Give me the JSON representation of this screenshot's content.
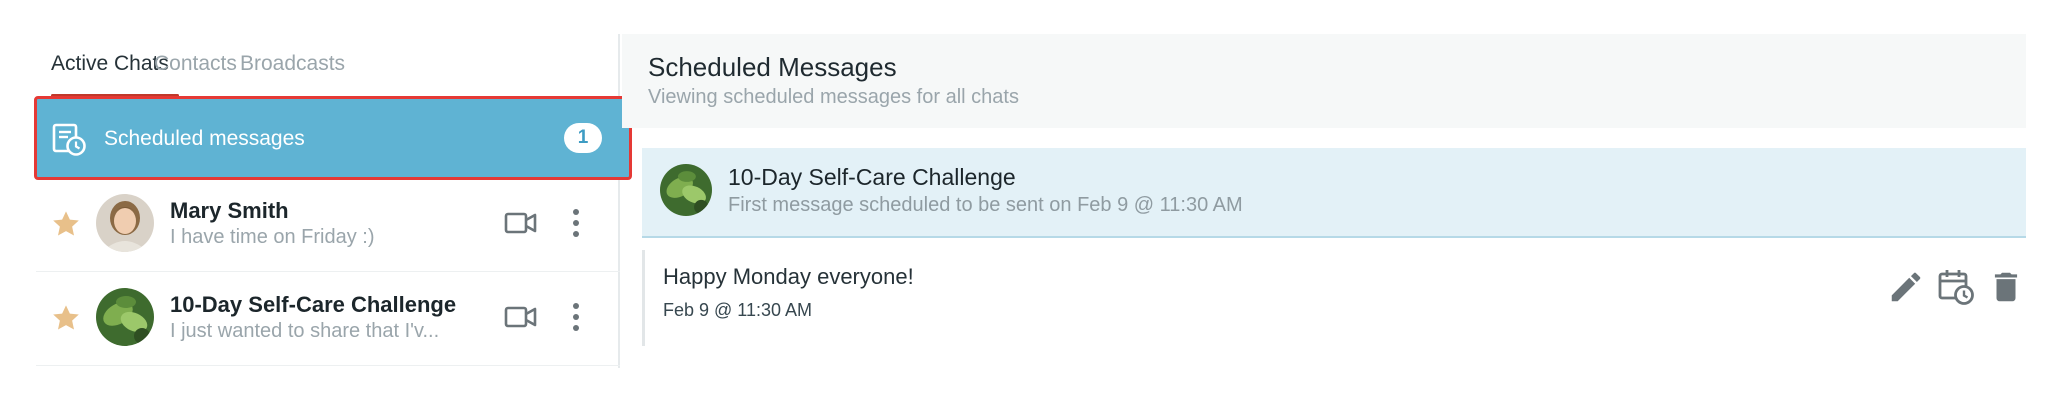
{
  "tabs": [
    {
      "label": "Active Chats",
      "active": true
    },
    {
      "label": "Contacts",
      "active": false
    },
    {
      "label": "Broadcasts",
      "active": false
    }
  ],
  "scheduled": {
    "label": "Scheduled messages",
    "count": "1",
    "icon": "scheduled-message-icon"
  },
  "chats": [
    {
      "name": "Mary Smith",
      "preview": "I have time on Friday :)",
      "starred": true
    },
    {
      "name": "10-Day Self-Care Challenge",
      "preview": "I just wanted to share that I'v...",
      "starred": true
    }
  ],
  "main": {
    "title": "Scheduled Messages",
    "subtitle": "Viewing scheduled messages for all chats",
    "group": {
      "name": "10-Day Self-Care Challenge",
      "subtitle": "First message scheduled to be sent on Feb 9 @ 11:30 AM"
    },
    "message": {
      "text": "Happy Monday everyone!",
      "time": "Feb 9 @ 11:30 AM"
    }
  },
  "colors": {
    "accent": "#5fb3d3",
    "highlight_border": "#e53935",
    "tab_underline": "#c0392b",
    "star": "#e8c08a"
  }
}
